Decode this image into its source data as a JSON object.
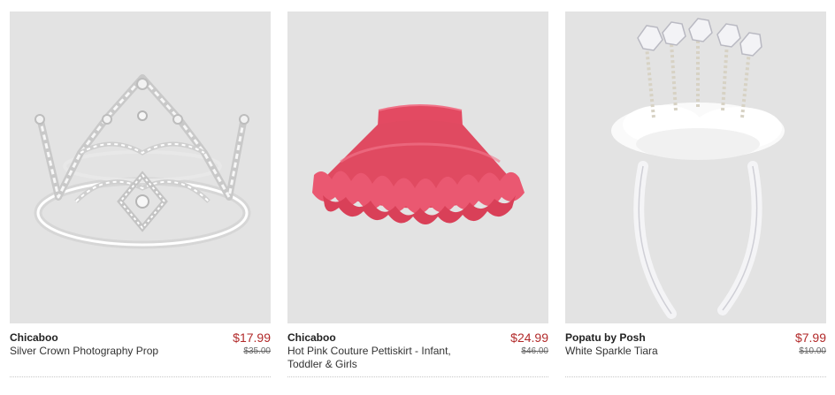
{
  "products": [
    {
      "brand": "Chicaboo",
      "title": "Silver Crown Photography Prop",
      "price": "$17.99",
      "original_price": "$35.00",
      "image": "silver-crown"
    },
    {
      "brand": "Chicaboo",
      "title": "Hot Pink Couture Pettiskirt - Infant, Toddler & Girls",
      "price": "$24.99",
      "original_price": "$46.00",
      "image": "pink-pettiskirt"
    },
    {
      "brand": "Popatu by Posh",
      "title": "White Sparkle Tiara",
      "price": "$7.99",
      "original_price": "$10.00",
      "image": "white-sparkle-tiara"
    }
  ],
  "colors": {
    "sale_price": "#b22a2a",
    "photo_background": "#e3e3e3"
  }
}
